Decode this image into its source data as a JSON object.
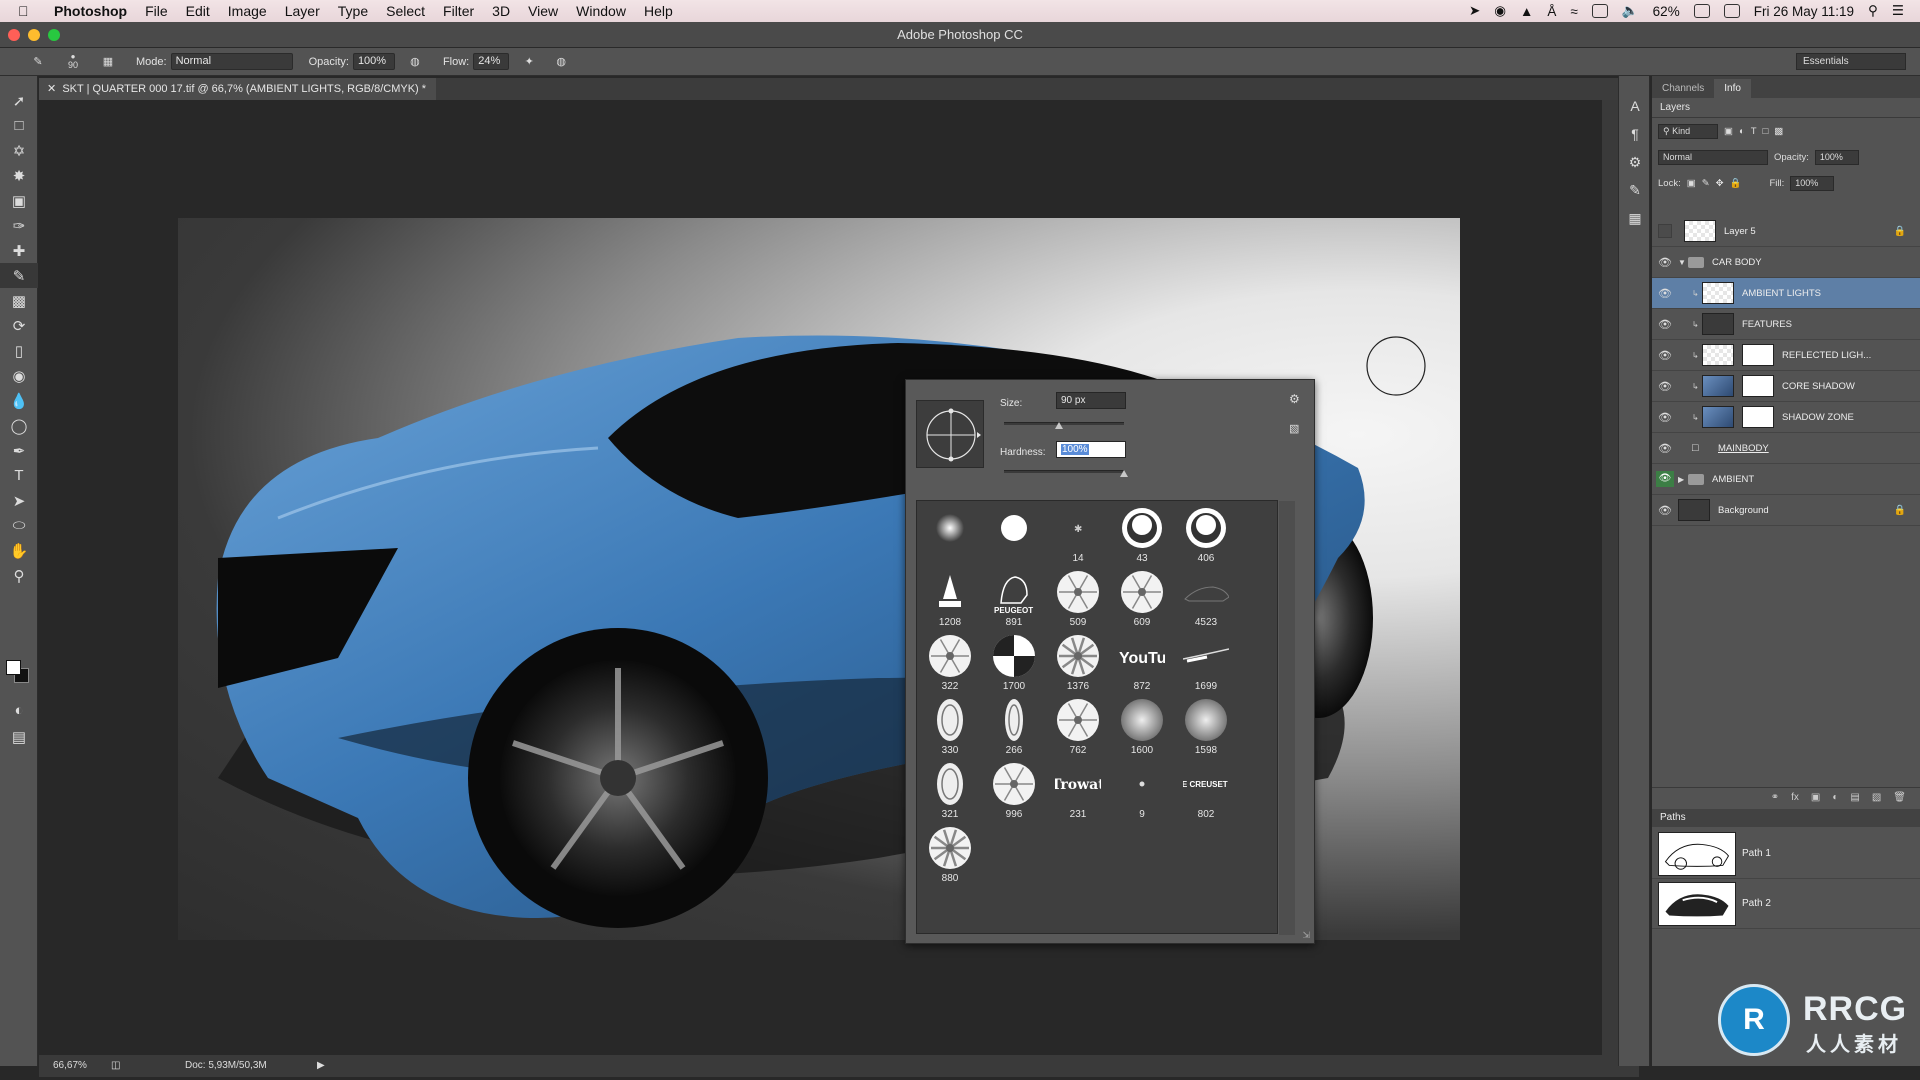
{
  "menubar": {
    "app_name": "Photoshop",
    "items": [
      "File",
      "Edit",
      "Image",
      "Layer",
      "Type",
      "Select",
      "Filter",
      "3D",
      "View",
      "Window",
      "Help"
    ],
    "battery": "62%",
    "clock": "Fri 26 May  11:19"
  },
  "window": {
    "title": "Adobe Photoshop CC"
  },
  "options": {
    "brush_size": "90",
    "mode_label": "Mode:",
    "mode_value": "Normal",
    "opacity_label": "Opacity:",
    "opacity_value": "100%",
    "flow_label": "Flow:",
    "flow_value": "24%",
    "workspace": "Essentials"
  },
  "document": {
    "tab_title": "SKT | QUARTER 000 17.tif @ 66,7% (AMBIENT LIGHTS, RGB/8/CMYK) *",
    "zoom": "66,67%",
    "doc_info": "Doc: 5,93M/50,3M"
  },
  "brush_picker": {
    "size_label": "Size:",
    "size_value": "90 px",
    "hardness_label": "Hardness:",
    "hardness_value": "100%",
    "size_fraction": 0.46,
    "hardness_fraction": 1.0,
    "presets": [
      {
        "num": "",
        "kind": "soft"
      },
      {
        "num": "",
        "kind": "hard"
      },
      {
        "num": "14",
        "kind": "tiny"
      },
      {
        "num": "43",
        "kind": "ring"
      },
      {
        "num": "406",
        "kind": "ring-big"
      },
      {
        "num": "1208",
        "kind": "pen"
      },
      {
        "num": "891",
        "kind": "lion",
        "text": "PEUGEOT"
      },
      {
        "num": "509",
        "kind": "wheel"
      },
      {
        "num": "609",
        "kind": "wheel-star"
      },
      {
        "num": "4523",
        "kind": "car"
      },
      {
        "num": "322",
        "kind": "wheel-spiral"
      },
      {
        "num": "1700",
        "kind": "checker"
      },
      {
        "num": "1376",
        "kind": "wheel-spokes"
      },
      {
        "num": "872",
        "kind": "youtube",
        "text": "YouTube"
      },
      {
        "num": "1699",
        "kind": "stroke"
      },
      {
        "num": "330",
        "kind": "ellipse-wheel"
      },
      {
        "num": "266",
        "kind": "ellipse-thin"
      },
      {
        "num": "762",
        "kind": "wheel"
      },
      {
        "num": "1600",
        "kind": "metal"
      },
      {
        "num": "1598",
        "kind": "metal"
      },
      {
        "num": "321",
        "kind": "ellipse-wheel"
      },
      {
        "num": "996",
        "kind": "wheel-fine"
      },
      {
        "num": "231",
        "kind": "text",
        "text": "Trowatt"
      },
      {
        "num": "9",
        "kind": "dot"
      },
      {
        "num": "802",
        "kind": "text-small",
        "text": "LE CREUSET"
      },
      {
        "num": "880",
        "kind": "wheel-spokes"
      }
    ]
  },
  "panels": {
    "top_tabs": [
      "Channels",
      "Info"
    ],
    "layers_title": "Layers",
    "kind_label": "Kind",
    "blend_mode": "Normal",
    "opacity_label": "Opacity:",
    "opacity_value": "100%",
    "lock_label": "Lock:",
    "fill_label": "Fill:",
    "fill_value": "100%",
    "layers": [
      {
        "name": "Layer 5",
        "type": "layer",
        "visible": false,
        "locked": true
      },
      {
        "name": "CAR BODY",
        "type": "group-open",
        "visible": true
      },
      {
        "name": "AMBIENT LIGHTS",
        "type": "clip",
        "visible": true,
        "selected": true
      },
      {
        "name": "FEATURES",
        "type": "clip",
        "visible": true
      },
      {
        "name": "REFLECTED LIGH...",
        "type": "clip-mask",
        "visible": true
      },
      {
        "name": "CORE SHADOW",
        "type": "clip-mask",
        "visible": true
      },
      {
        "name": "SHADOW ZONE",
        "type": "clip-mask",
        "visible": true
      },
      {
        "name": "MAINBODY",
        "type": "artboard",
        "visible": true
      },
      {
        "name": "AMBIENT",
        "type": "group-closed",
        "visible": true,
        "green": true
      },
      {
        "name": "Background",
        "type": "background",
        "visible": true,
        "locked": true
      }
    ],
    "paths_title": "Paths",
    "paths": [
      "Path 1",
      "Path 2"
    ]
  },
  "brand": {
    "logo_letters": "RRCG",
    "logo_sub": "人人素材"
  },
  "colors": {
    "panel_bg": "#535353",
    "selection": "#5e7fa6",
    "car_blue": "#3b78b5"
  }
}
